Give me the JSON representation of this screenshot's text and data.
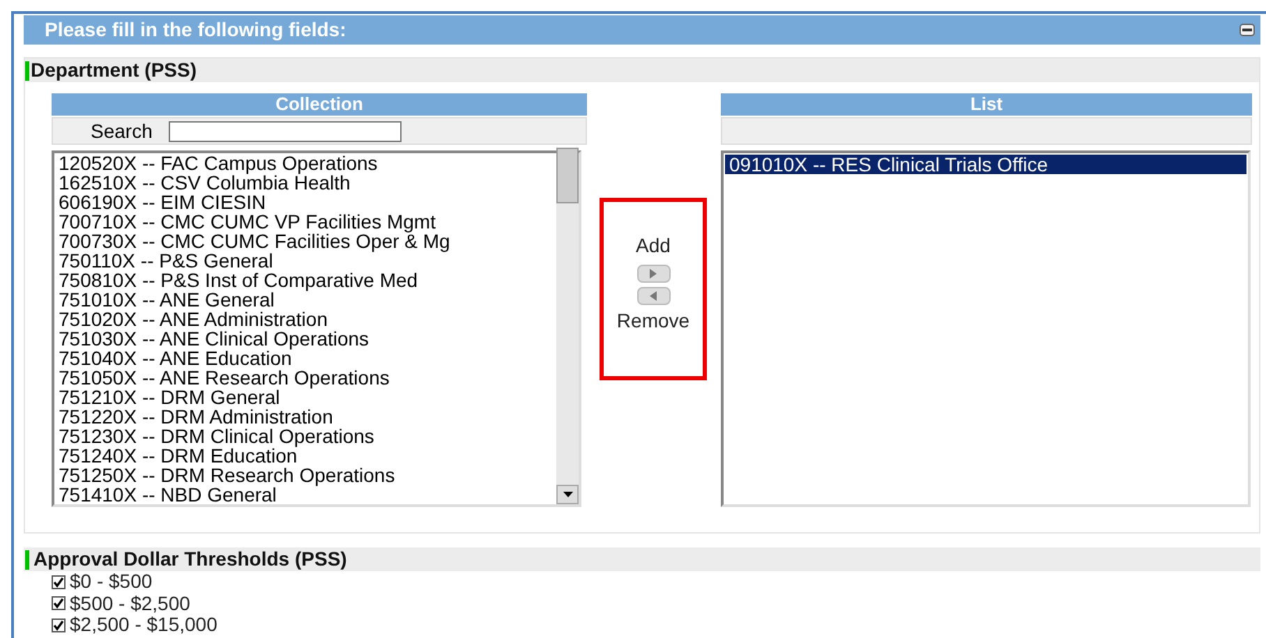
{
  "panel": {
    "title": "Please fill in the following fields:"
  },
  "department": {
    "label": "Department (PSS)",
    "collection": {
      "title": "Collection",
      "search_label": "Search",
      "items": [
        {
          "text": "120520X -- FAC Campus Operations",
          "selected": false
        },
        {
          "text": "162510X -- CSV Columbia Health",
          "selected": false
        },
        {
          "text": "606190X -- EIM CIESIN",
          "selected": false
        },
        {
          "text": "700710X -- CMC CUMC VP Facilities Mgmt",
          "selected": false
        },
        {
          "text": "700730X -- CMC CUMC Facilities Oper & Mg",
          "selected": false
        },
        {
          "text": "750110X -- P&S General",
          "selected": false
        },
        {
          "text": "750810X -- P&S Inst of Comparative Med",
          "selected": false
        },
        {
          "text": "751010X -- ANE General",
          "selected": false
        },
        {
          "text": "751020X -- ANE Administration",
          "selected": false
        },
        {
          "text": "751030X -- ANE Clinical Operations",
          "selected": false
        },
        {
          "text": "751040X -- ANE Education",
          "selected": false
        },
        {
          "text": "751050X -- ANE Research Operations",
          "selected": false
        },
        {
          "text": "751210X -- DRM General",
          "selected": false
        },
        {
          "text": "751220X -- DRM Administration",
          "selected": false
        },
        {
          "text": "751230X -- DRM Clinical Operations",
          "selected": false
        },
        {
          "text": "751240X -- DRM Education",
          "selected": false
        },
        {
          "text": "751250X -- DRM Research Operations",
          "selected": false
        },
        {
          "text": "751410X -- NBD General",
          "selected": false
        }
      ]
    },
    "add_label": "Add",
    "remove_label": "Remove",
    "list": {
      "title": "List",
      "items": [
        {
          "text": "091010X -- RES Clinical Trials Office",
          "selected": true
        }
      ]
    }
  },
  "thresholds": {
    "label": "Approval Dollar Thresholds (PSS)",
    "options": [
      {
        "label": "$0 - $500",
        "checked": true
      },
      {
        "label": "$500 - $2,500",
        "checked": true
      },
      {
        "label": "$2,500 - $15,000",
        "checked": true
      }
    ]
  }
}
